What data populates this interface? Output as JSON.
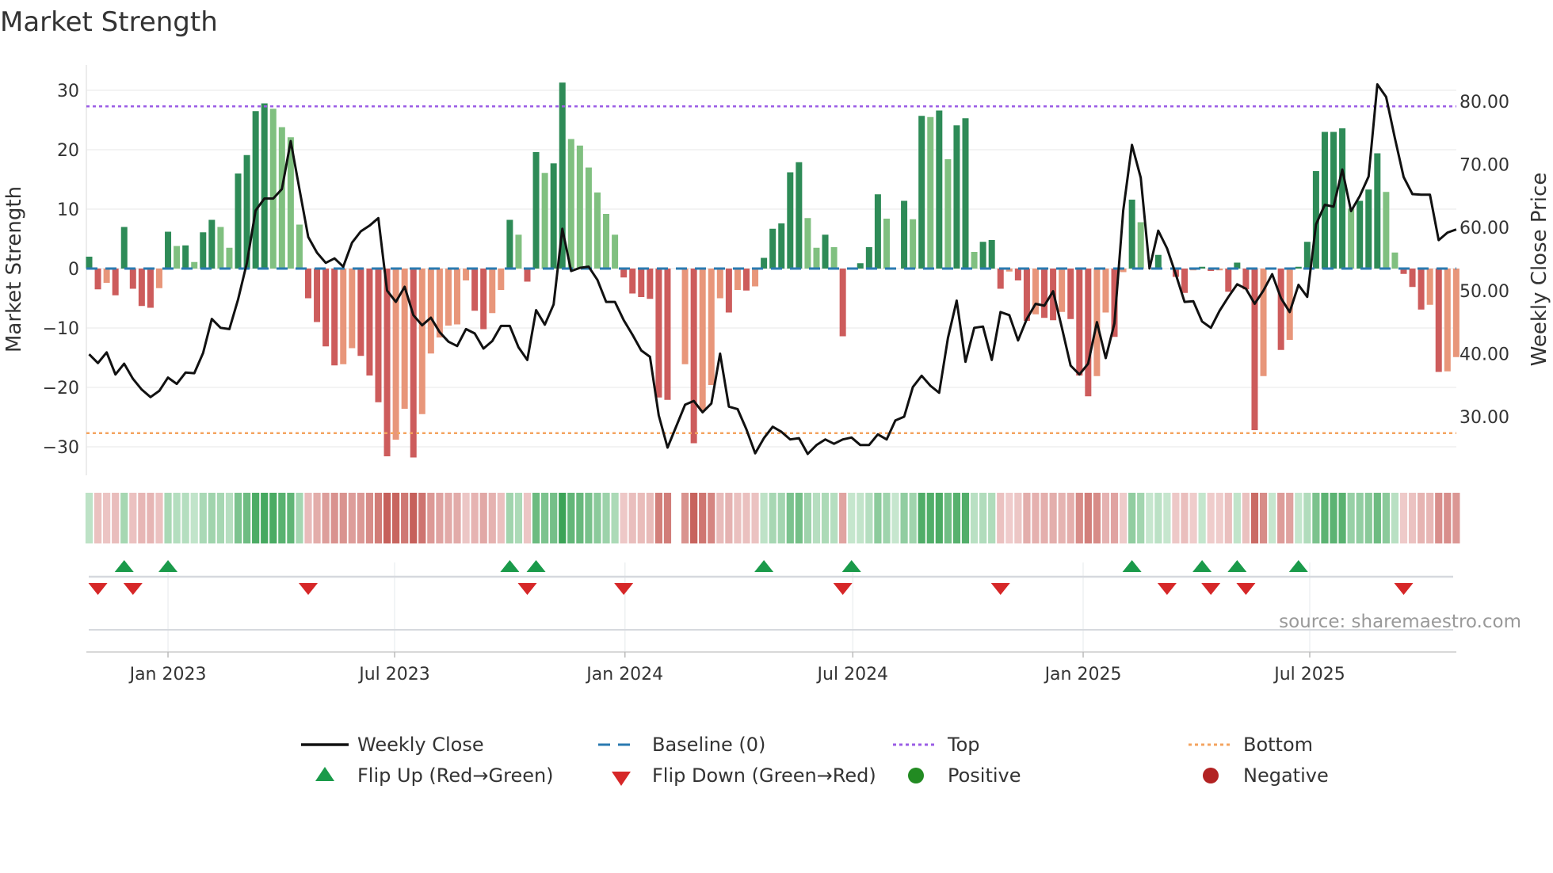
{
  "title": "Market Strength",
  "source": "source: sharemaestro.com",
  "colors": {
    "pos_strong": "#2e8b57",
    "pos_weak": "#80c080",
    "neg_strong": "#cd5c5c",
    "neg_weak": "#e8967a",
    "close": "#111111",
    "baseline": "#2a7ab0",
    "top": "#9b5de5",
    "bottom": "#f4a460",
    "flip_up": "#1a9a4a",
    "flip_down": "#d62728",
    "positive": "#228b22",
    "negative": "#b22222"
  },
  "legend": {
    "weekly_close": "Weekly Close",
    "baseline": "Baseline (0)",
    "top": "Top",
    "bottom": "Bottom",
    "flip_up": "Flip Up (Red→Green)",
    "flip_down": "Flip Down (Green→Red)",
    "positive": "Positive",
    "negative": "Negative"
  },
  "chart_data": {
    "type": "bar",
    "title": "Market Strength",
    "ylabel": "Market Strength",
    "y2label": "Weekly Close Price",
    "ylim": [
      -34,
      35
    ],
    "y2lim": [
      24.5,
      87.5
    ],
    "x_start": "2022-10-30",
    "frequency": "weekly",
    "yticks": [
      "30",
      "20",
      "10",
      "0",
      "−10",
      "−20",
      "−30"
    ],
    "ytick_values": [
      30,
      20,
      10,
      0,
      -10,
      -20,
      -30
    ],
    "y2ticks": [
      "80.00",
      "70.00",
      "60.00",
      "50.00",
      "40.00",
      "30.00"
    ],
    "y2tick_values": [
      80,
      70,
      60,
      50,
      40,
      30
    ],
    "xticks": [
      {
        "label": "Jan 2023",
        "date": "2023-01-01"
      },
      {
        "label": "Jul 2023",
        "date": "2023-07-01"
      },
      {
        "label": "Jan 2024",
        "date": "2024-01-01"
      },
      {
        "label": "Jul 2024",
        "date": "2024-07-01"
      },
      {
        "label": "Jan 2025",
        "date": "2025-01-01"
      },
      {
        "label": "Jul 2025",
        "date": "2025-07-01"
      }
    ],
    "top_level": 27.3,
    "bottom_level": -27.7,
    "baseline": 0,
    "strength": [
      2.0,
      -3.5,
      -2.4,
      -4.5,
      7.0,
      -3.4,
      -6.3,
      -6.6,
      -3.3,
      6.2,
      3.8,
      3.9,
      1.1,
      6.1,
      8.2,
      7.0,
      3.5,
      16.0,
      19.1,
      26.5,
      27.8,
      26.9,
      23.8,
      22.1,
      7.4,
      -5.0,
      -9.0,
      -13.1,
      -16.3,
      -16.1,
      -13.4,
      -14.7,
      -18.0,
      -22.5,
      -31.6,
      -28.8,
      -23.6,
      -31.8,
      -24.5,
      -14.3,
      -11.6,
      -9.6,
      -9.4,
      -2.0,
      -7.1,
      -10.2,
      -7.5,
      -3.6,
      8.2,
      5.7,
      -2.2,
      19.6,
      16.1,
      17.7,
      31.3,
      21.8,
      20.7,
      17.0,
      12.8,
      9.2,
      5.7,
      -1.5,
      -4.2,
      -4.8,
      -5.1,
      -21.7,
      -22.1,
      null,
      -16.1,
      -29.4,
      -24.0,
      -19.6,
      -5.0,
      -7.4,
      -3.6,
      -3.7,
      -3.0,
      1.8,
      6.7,
      7.6,
      16.2,
      17.9,
      8.5,
      3.5,
      5.7,
      3.6,
      -11.4,
      0.2,
      0.9,
      3.6,
      12.5,
      8.4,
      0,
      11.4,
      8.3,
      25.7,
      25.5,
      26.6,
      18.4,
      24.1,
      25.3,
      2.8,
      4.5,
      4.8,
      -3.4,
      -0.5,
      -2.0,
      -8.8,
      -7.7,
      -8.3,
      -8.7,
      -7.3,
      -8.5,
      -18.0,
      -21.5,
      -18.1,
      -7.4,
      -11.5,
      -0.6,
      11.6,
      7.8,
      0,
      2.3,
      0,
      -1.4,
      -4.1,
      -0.3,
      0.3,
      -0.4,
      -0.3,
      -3.9,
      1.0,
      -3.5,
      -27.2,
      -18.1,
      0,
      -13.7,
      -12.0,
      0.3,
      4.5,
      16.4,
      23.0,
      23.0,
      23.6,
      10.1,
      11.4,
      13.3,
      19.4,
      12.9,
      2.7,
      -0.9,
      -3.1,
      -6.9,
      -6.1,
      -17.4,
      -17.3,
      -14.9
    ],
    "weekly_close": [
      39.9,
      38.5,
      40.2,
      36.7,
      38.4,
      36.0,
      34.3,
      33.1,
      34.1,
      36.2,
      35.2,
      37.0,
      36.9,
      40.1,
      45.5,
      44.1,
      43.9,
      48.6,
      54.4,
      62.7,
      64.6,
      64.6,
      66.1,
      73.7,
      66.1,
      58.5,
      56.0,
      54.4,
      55.1,
      53.8,
      57.6,
      59.4,
      60.3,
      61.5,
      50.0,
      48.2,
      50.6,
      46.1,
      44.5,
      45.7,
      43.4,
      41.9,
      41.2,
      43.9,
      43.2,
      40.8,
      42.0,
      44.4,
      44.4,
      41.0,
      39.0,
      46.9,
      44.6,
      47.8,
      59.8,
      53.1,
      53.6,
      53.8,
      51.7,
      48.2,
      48.2,
      45.3,
      43.0,
      40.5,
      39.5,
      30.2,
      25.1,
      null,
      31.9,
      32.5,
      30.7,
      32.1,
      40.0,
      31.6,
      31.2,
      28.0,
      24.2,
      26.6,
      28.4,
      27.6,
      26.4,
      26.6,
      24.1,
      25.5,
      26.4,
      25.7,
      26.4,
      26.7,
      25.5,
      25.5,
      27.2,
      26.4,
      29.4,
      30.0,
      34.7,
      36.5,
      34.9,
      33.8,
      42.5,
      48.4,
      38.7,
      44.1,
      44.3,
      39.0,
      46.6,
      46.1,
      42.1,
      45.5,
      47.9,
      47.6,
      49.9,
      44.1,
      38.1,
      36.7,
      38.4,
      45.0,
      39.3,
      44.8,
      62.7,
      73.1,
      67.9,
      53.5,
      59.5,
      56.7,
      52.6,
      48.2,
      48.3,
      45.1,
      44.1,
      46.8,
      49.0,
      51.0,
      50.3,
      47.9,
      50.0,
      52.6,
      48.8,
      46.6,
      50.9,
      49.0,
      60.5,
      63.6,
      63.3,
      69.2,
      62.6,
      65.0,
      68.1,
      82.7,
      80.7,
      74.2,
      68.0,
      65.3,
      65.2,
      65.2,
      58.0,
      59.2,
      59.7
    ],
    "flip_up_weeks": [
      4,
      9,
      48,
      51,
      77,
      87,
      119,
      127,
      131,
      138
    ],
    "flip_down_weeks": [
      1,
      5,
      25,
      50,
      61,
      86,
      104,
      123,
      128,
      132,
      150
    ]
  }
}
